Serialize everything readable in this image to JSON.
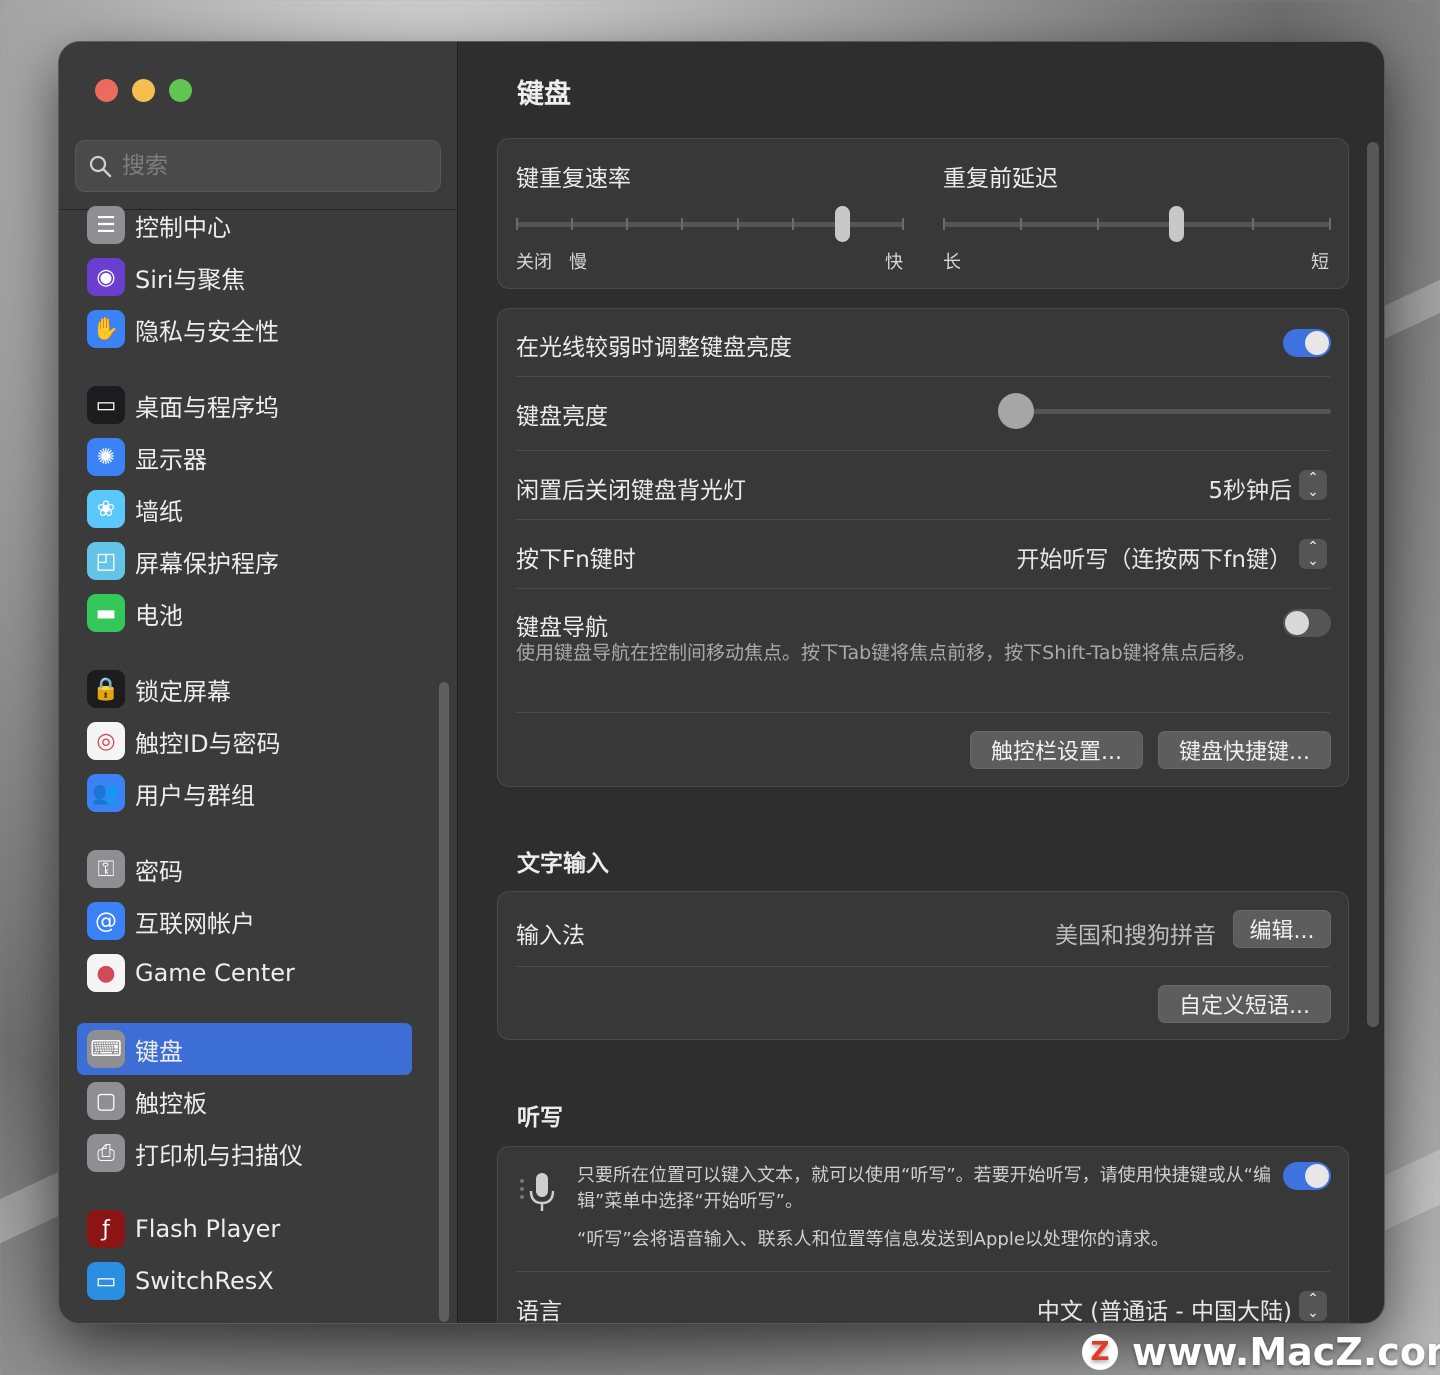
{
  "search": {
    "placeholder": "搜索"
  },
  "sidebar": {
    "items": [
      {
        "label": "控制中心",
        "icon": "control-center-icon",
        "color": "#8e8e93"
      },
      {
        "label": "Siri与聚焦",
        "icon": "siri-icon",
        "color": "#6a3fd0"
      },
      {
        "label": "隐私与安全性",
        "icon": "hand-icon",
        "color": "#3b82f6"
      },
      {
        "label": "桌面与程序坞",
        "icon": "dock-icon",
        "color": "#1c1c1e"
      },
      {
        "label": "显示器",
        "icon": "sun-icon",
        "color": "#3b82f6"
      },
      {
        "label": "墙纸",
        "icon": "flower-icon",
        "color": "#5ac8fa"
      },
      {
        "label": "屏幕保护程序",
        "icon": "screensaver-icon",
        "color": "#64c4e8"
      },
      {
        "label": "电池",
        "icon": "battery-icon",
        "color": "#34c759"
      },
      {
        "label": "锁定屏幕",
        "icon": "lock-icon",
        "color": "#1c1c1e"
      },
      {
        "label": "触控ID与密码",
        "icon": "fingerprint-icon",
        "color": "#f5f5f5"
      },
      {
        "label": "用户与群组",
        "icon": "users-icon",
        "color": "#3b82f6"
      },
      {
        "label": "密码",
        "icon": "key-icon",
        "color": "#8e8e93"
      },
      {
        "label": "互联网帐户",
        "icon": "at-icon",
        "color": "#3b82f6"
      },
      {
        "label": "Game Center",
        "icon": "game-center-icon",
        "color": "#f5f5f5"
      },
      {
        "label": "键盘",
        "icon": "keyboard-icon",
        "color": "#8e8e93"
      },
      {
        "label": "触控板",
        "icon": "trackpad-icon",
        "color": "#8e8e93"
      },
      {
        "label": "打印机与扫描仪",
        "icon": "printer-icon",
        "color": "#8e8e93"
      },
      {
        "label": "Flash Player",
        "icon": "flash-icon",
        "color": "#8b1414"
      },
      {
        "label": "SwitchResX",
        "icon": "monitor-icon",
        "color": "#2a8fe0"
      }
    ]
  },
  "main": {
    "title": "键盘",
    "repeat": {
      "rate_label": "键重复速率",
      "rate_off": "关闭",
      "rate_slow": "慢",
      "rate_fast": "快",
      "rate_value": 0.84,
      "delay_label": "重复前延迟",
      "delay_long": "长",
      "delay_short": "短",
      "delay_value": 0.6
    },
    "backlight": {
      "auto_label": "在光线较弱时调整键盘亮度",
      "auto_on": true,
      "brightness_label": "键盘亮度",
      "brightness_value": 0.0,
      "idle_label": "闲置后关闭键盘背光灯",
      "idle_value": "5秒钟后",
      "fn_label": "按下Fn键时",
      "fn_value": "开始听写（连按两下fn键）",
      "nav_label": "键盘导航",
      "nav_desc": "使用键盘导航在控制间移动焦点。按下Tab键将焦点前移，按下Shift-Tab键将焦点后移。",
      "nav_on": false,
      "touchbar_button": "触控栏设置...",
      "shortcuts_button": "键盘快捷键..."
    },
    "text_input": {
      "section_title": "文字输入",
      "input_label": "输入法",
      "input_value": "美国和搜狗拼音",
      "edit_button": "编辑...",
      "phrases_button": "自定义短语..."
    },
    "dictation": {
      "section_title": "听写",
      "desc1": "只要所在位置可以键入文本，就可以使用“听写”。若要开始听写，请使用快捷键或从“编辑”菜单中选择“开始听写”。",
      "desc2": "“听写”会将语音输入、联系人和位置等信息发送到Apple以处理你的请求。",
      "on": true,
      "language_label": "语言",
      "language_value": "中文 (普通话 - 中国大陆)"
    }
  },
  "watermark": {
    "logo": "Z",
    "text": "www.MacZ.com"
  },
  "colors": {
    "accent": "#3d6ed6",
    "toggle_on": "#3d72e0"
  }
}
